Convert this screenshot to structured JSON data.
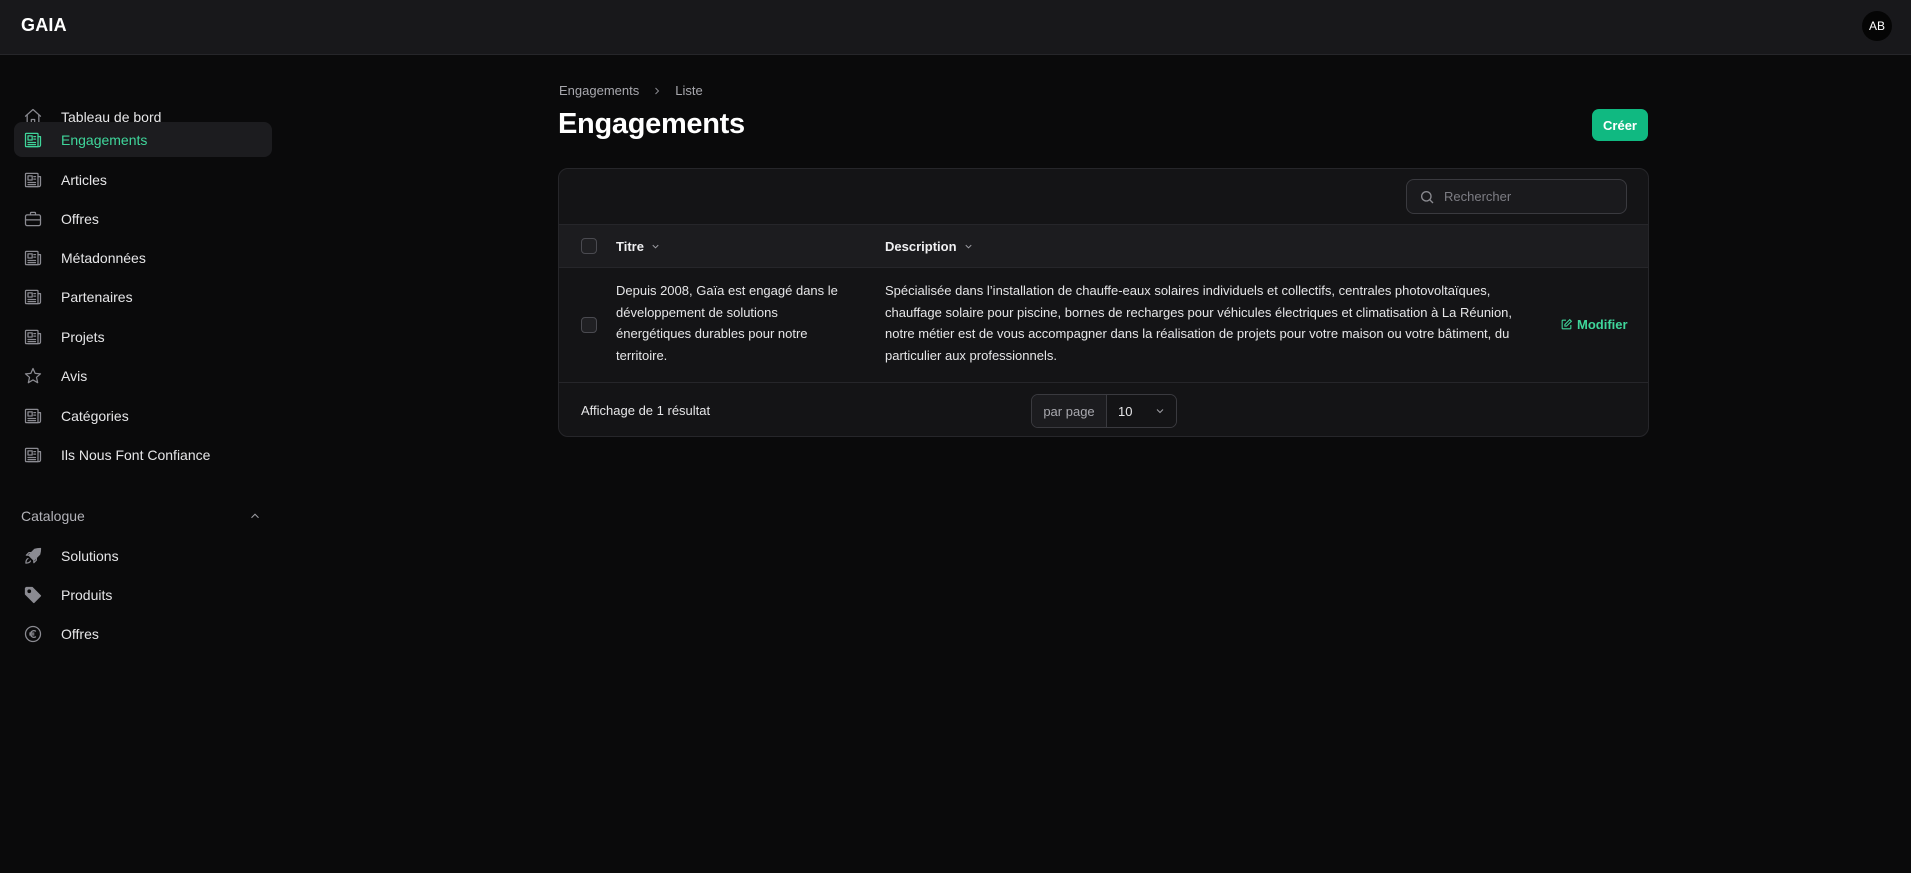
{
  "app": {
    "brand": "GAIA",
    "user_initials": "AB"
  },
  "sidebar": {
    "items": [
      {
        "label": "Tableau de bord",
        "icon": "home-icon",
        "active": false
      },
      {
        "label": "Engagements",
        "icon": "newspaper-icon",
        "active": true
      },
      {
        "label": "Articles",
        "icon": "newspaper-icon",
        "active": false
      },
      {
        "label": "Offres",
        "icon": "briefcase-icon",
        "active": false
      },
      {
        "label": "Métadonnées",
        "icon": "newspaper-icon",
        "active": false
      },
      {
        "label": "Partenaires",
        "icon": "newspaper-icon",
        "active": false
      },
      {
        "label": "Projets",
        "icon": "newspaper-icon",
        "active": false
      },
      {
        "label": "Avis",
        "icon": "star-icon",
        "active": false
      },
      {
        "label": "Catégories",
        "icon": "newspaper-icon",
        "active": false
      },
      {
        "label": "Ils Nous Font Confiance",
        "icon": "newspaper-icon",
        "active": false
      }
    ],
    "group": {
      "title": "Catalogue",
      "expanded": true,
      "items": [
        {
          "label": "Solutions",
          "icon": "rocket-icon"
        },
        {
          "label": "Produits",
          "icon": "tag-icon"
        },
        {
          "label": "Offres",
          "icon": "euro-icon"
        }
      ]
    }
  },
  "breadcrumb": {
    "parent": "Engagements",
    "current": "Liste"
  },
  "page": {
    "title": "Engagements",
    "create_label": "Créer"
  },
  "table": {
    "search_placeholder": "Rechercher",
    "columns": {
      "title": "Titre",
      "description": "Description"
    },
    "rows": [
      {
        "title": "Depuis 2008, Gaïa est engagé dans le développement de solutions énergétiques durables pour notre territoire.",
        "description": "Spécialisée dans l’installation de chauffe-eaux solaires individuels et collectifs, centrales photovoltaïques, chauffage solaire pour piscine, bornes de recharges pour véhicules électriques et climatisation à La Réunion, notre métier est de vous accompagner dans la réalisation de projets pour votre maison ou votre bâtiment, du particulier aux professionnels.",
        "action_label": "Modifier"
      }
    ],
    "footer": {
      "count_text": "Affichage de 1 résultat",
      "per_page_label": "par page",
      "per_page_value": "10"
    }
  },
  "colors": {
    "accent": "#10b981",
    "accent_text": "#3fd69b",
    "background": "#0a0a0b",
    "panel": "#141416"
  }
}
